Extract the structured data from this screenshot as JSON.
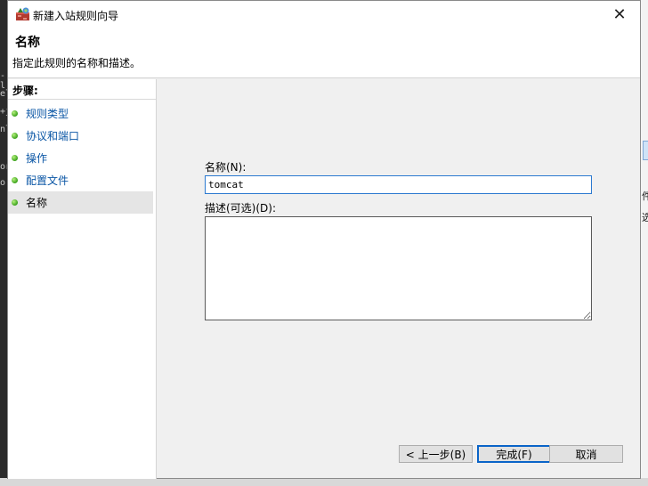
{
  "window": {
    "title": "新建入站规则向导",
    "close_symbol": "✕"
  },
  "header": {
    "title": "名称",
    "description": "指定此规则的名称和描述。"
  },
  "steps": {
    "heading": "步骤:",
    "items": [
      {
        "label": "规则类型",
        "active": false
      },
      {
        "label": "协议和端口",
        "active": false
      },
      {
        "label": "操作",
        "active": false
      },
      {
        "label": "配置文件",
        "active": false
      },
      {
        "label": "名称",
        "active": true
      }
    ]
  },
  "form": {
    "name_label": "名称(N):",
    "name_value": "tomcat",
    "description_label": "描述(可选)(D):",
    "description_value": ""
  },
  "buttons": {
    "back": "< 上一步(B)",
    "finish": "完成(F)",
    "cancel": "取消"
  },
  "background": {
    "left_fragments": [
      "-l",
      "el",
      "+j",
      "nl",
      "or",
      "o"
    ],
    "right_fragments": [
      "件",
      "选"
    ]
  }
}
